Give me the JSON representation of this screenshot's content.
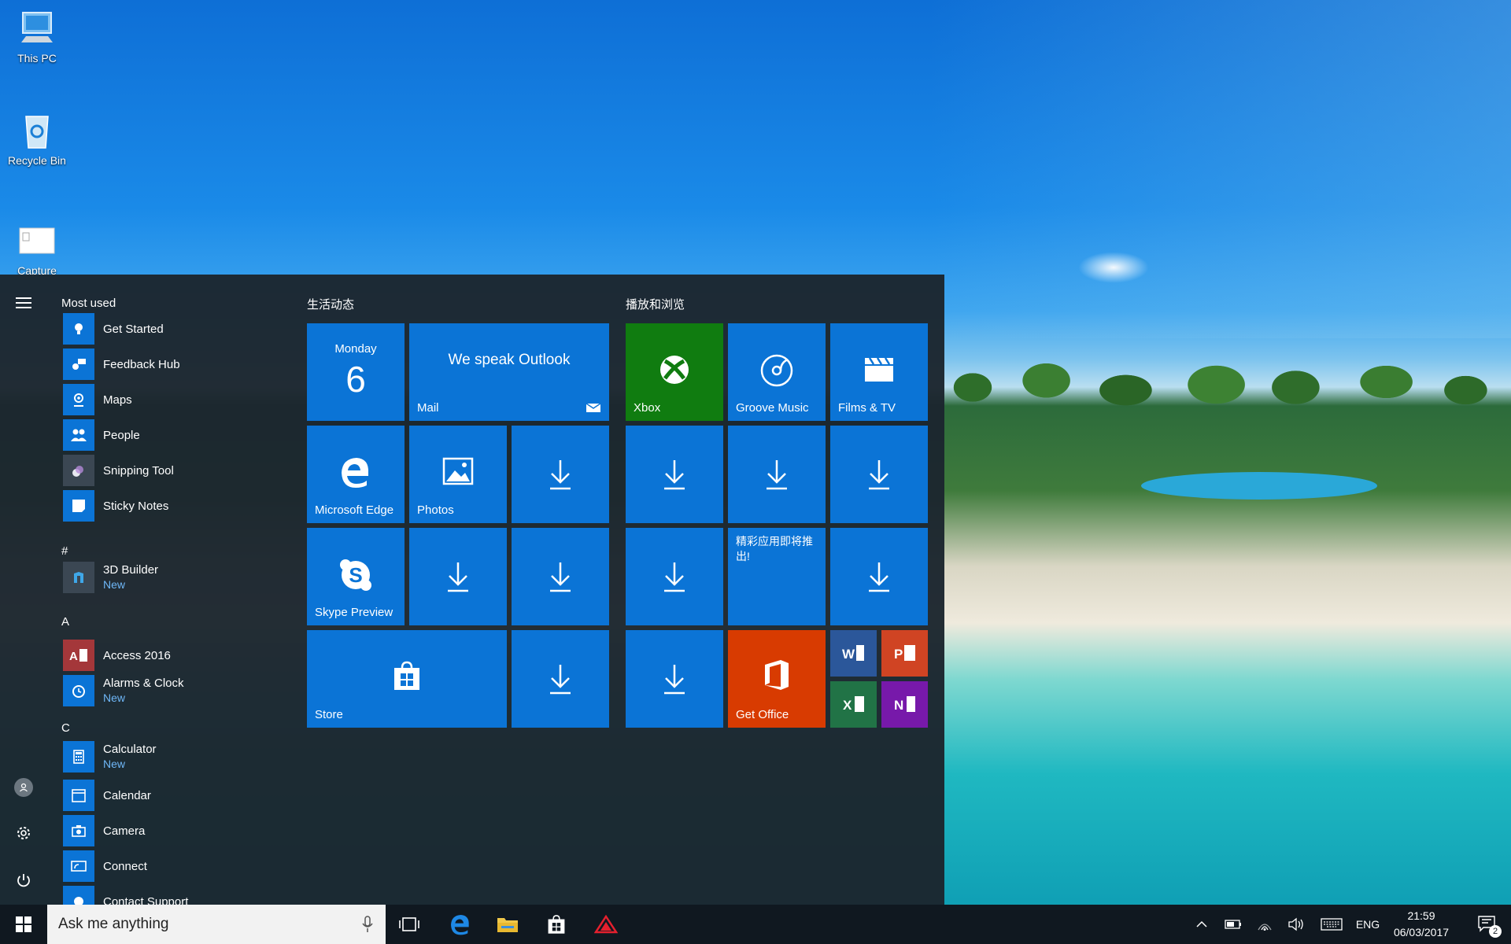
{
  "desktop": {
    "icons": [
      {
        "label": "This PC",
        "icon": "computer-icon"
      },
      {
        "label": "Recycle Bin",
        "icon": "recycle-bin-icon"
      },
      {
        "label": "Capture",
        "icon": "image-file-icon"
      }
    ]
  },
  "start_menu": {
    "most_used_header": "Most used",
    "most_used": [
      {
        "label": "Get Started",
        "icon": "lightbulb-icon"
      },
      {
        "label": "Feedback Hub",
        "icon": "feedback-icon"
      },
      {
        "label": "Maps",
        "icon": "map-pin-icon"
      },
      {
        "label": "People",
        "icon": "people-icon"
      },
      {
        "label": "Snipping Tool",
        "icon": "scissors-icon"
      },
      {
        "label": "Sticky Notes",
        "icon": "sticky-note-icon"
      }
    ],
    "sections": [
      {
        "letter": "#",
        "apps": [
          {
            "label": "3D Builder",
            "sub": "New",
            "icon": "3d-builder-icon"
          }
        ]
      },
      {
        "letter": "A",
        "apps": [
          {
            "label": "Access 2016",
            "icon": "access-icon"
          },
          {
            "label": "Alarms & Clock",
            "sub": "New",
            "icon": "alarm-clock-icon"
          }
        ]
      },
      {
        "letter": "C",
        "apps": [
          {
            "label": "Calculator",
            "sub": "New",
            "icon": "calculator-icon"
          },
          {
            "label": "Calendar",
            "icon": "calendar-icon"
          },
          {
            "label": "Camera",
            "icon": "camera-icon"
          },
          {
            "label": "Connect",
            "icon": "connect-icon"
          },
          {
            "label": "Contact Support",
            "icon": "contact-support-icon"
          }
        ]
      }
    ],
    "groups": [
      {
        "title": "生活动态"
      },
      {
        "title": "播放和浏览"
      }
    ],
    "tiles": {
      "calendar": {
        "day": "Monday",
        "date": "6"
      },
      "mail": {
        "headline": "We speak Outlook",
        "label": "Mail"
      },
      "edge": {
        "label": "Microsoft Edge"
      },
      "photos": {
        "label": "Photos"
      },
      "skype": {
        "label": "Skype Preview"
      },
      "store": {
        "label": "Store"
      },
      "xbox": {
        "label": "Xbox"
      },
      "groove": {
        "label": "Groove Music"
      },
      "films": {
        "label": "Films & TV"
      },
      "promo": {
        "text": "精彩应用即将推出!"
      },
      "office": {
        "label": "Get Office"
      }
    }
  },
  "taskbar": {
    "search_placeholder": "Ask me anything",
    "language": "ENG",
    "time": "21:59",
    "date": "06/03/2017",
    "notifications_count": "2"
  },
  "colors": {
    "tile_blue": "#0b74d6",
    "xbox_green": "#107c10",
    "office_orange": "#d83b01",
    "word_blue": "#2b579a",
    "powerpoint_red": "#d04423",
    "excel_green": "#217346",
    "onenote_purple": "#7719aa"
  }
}
